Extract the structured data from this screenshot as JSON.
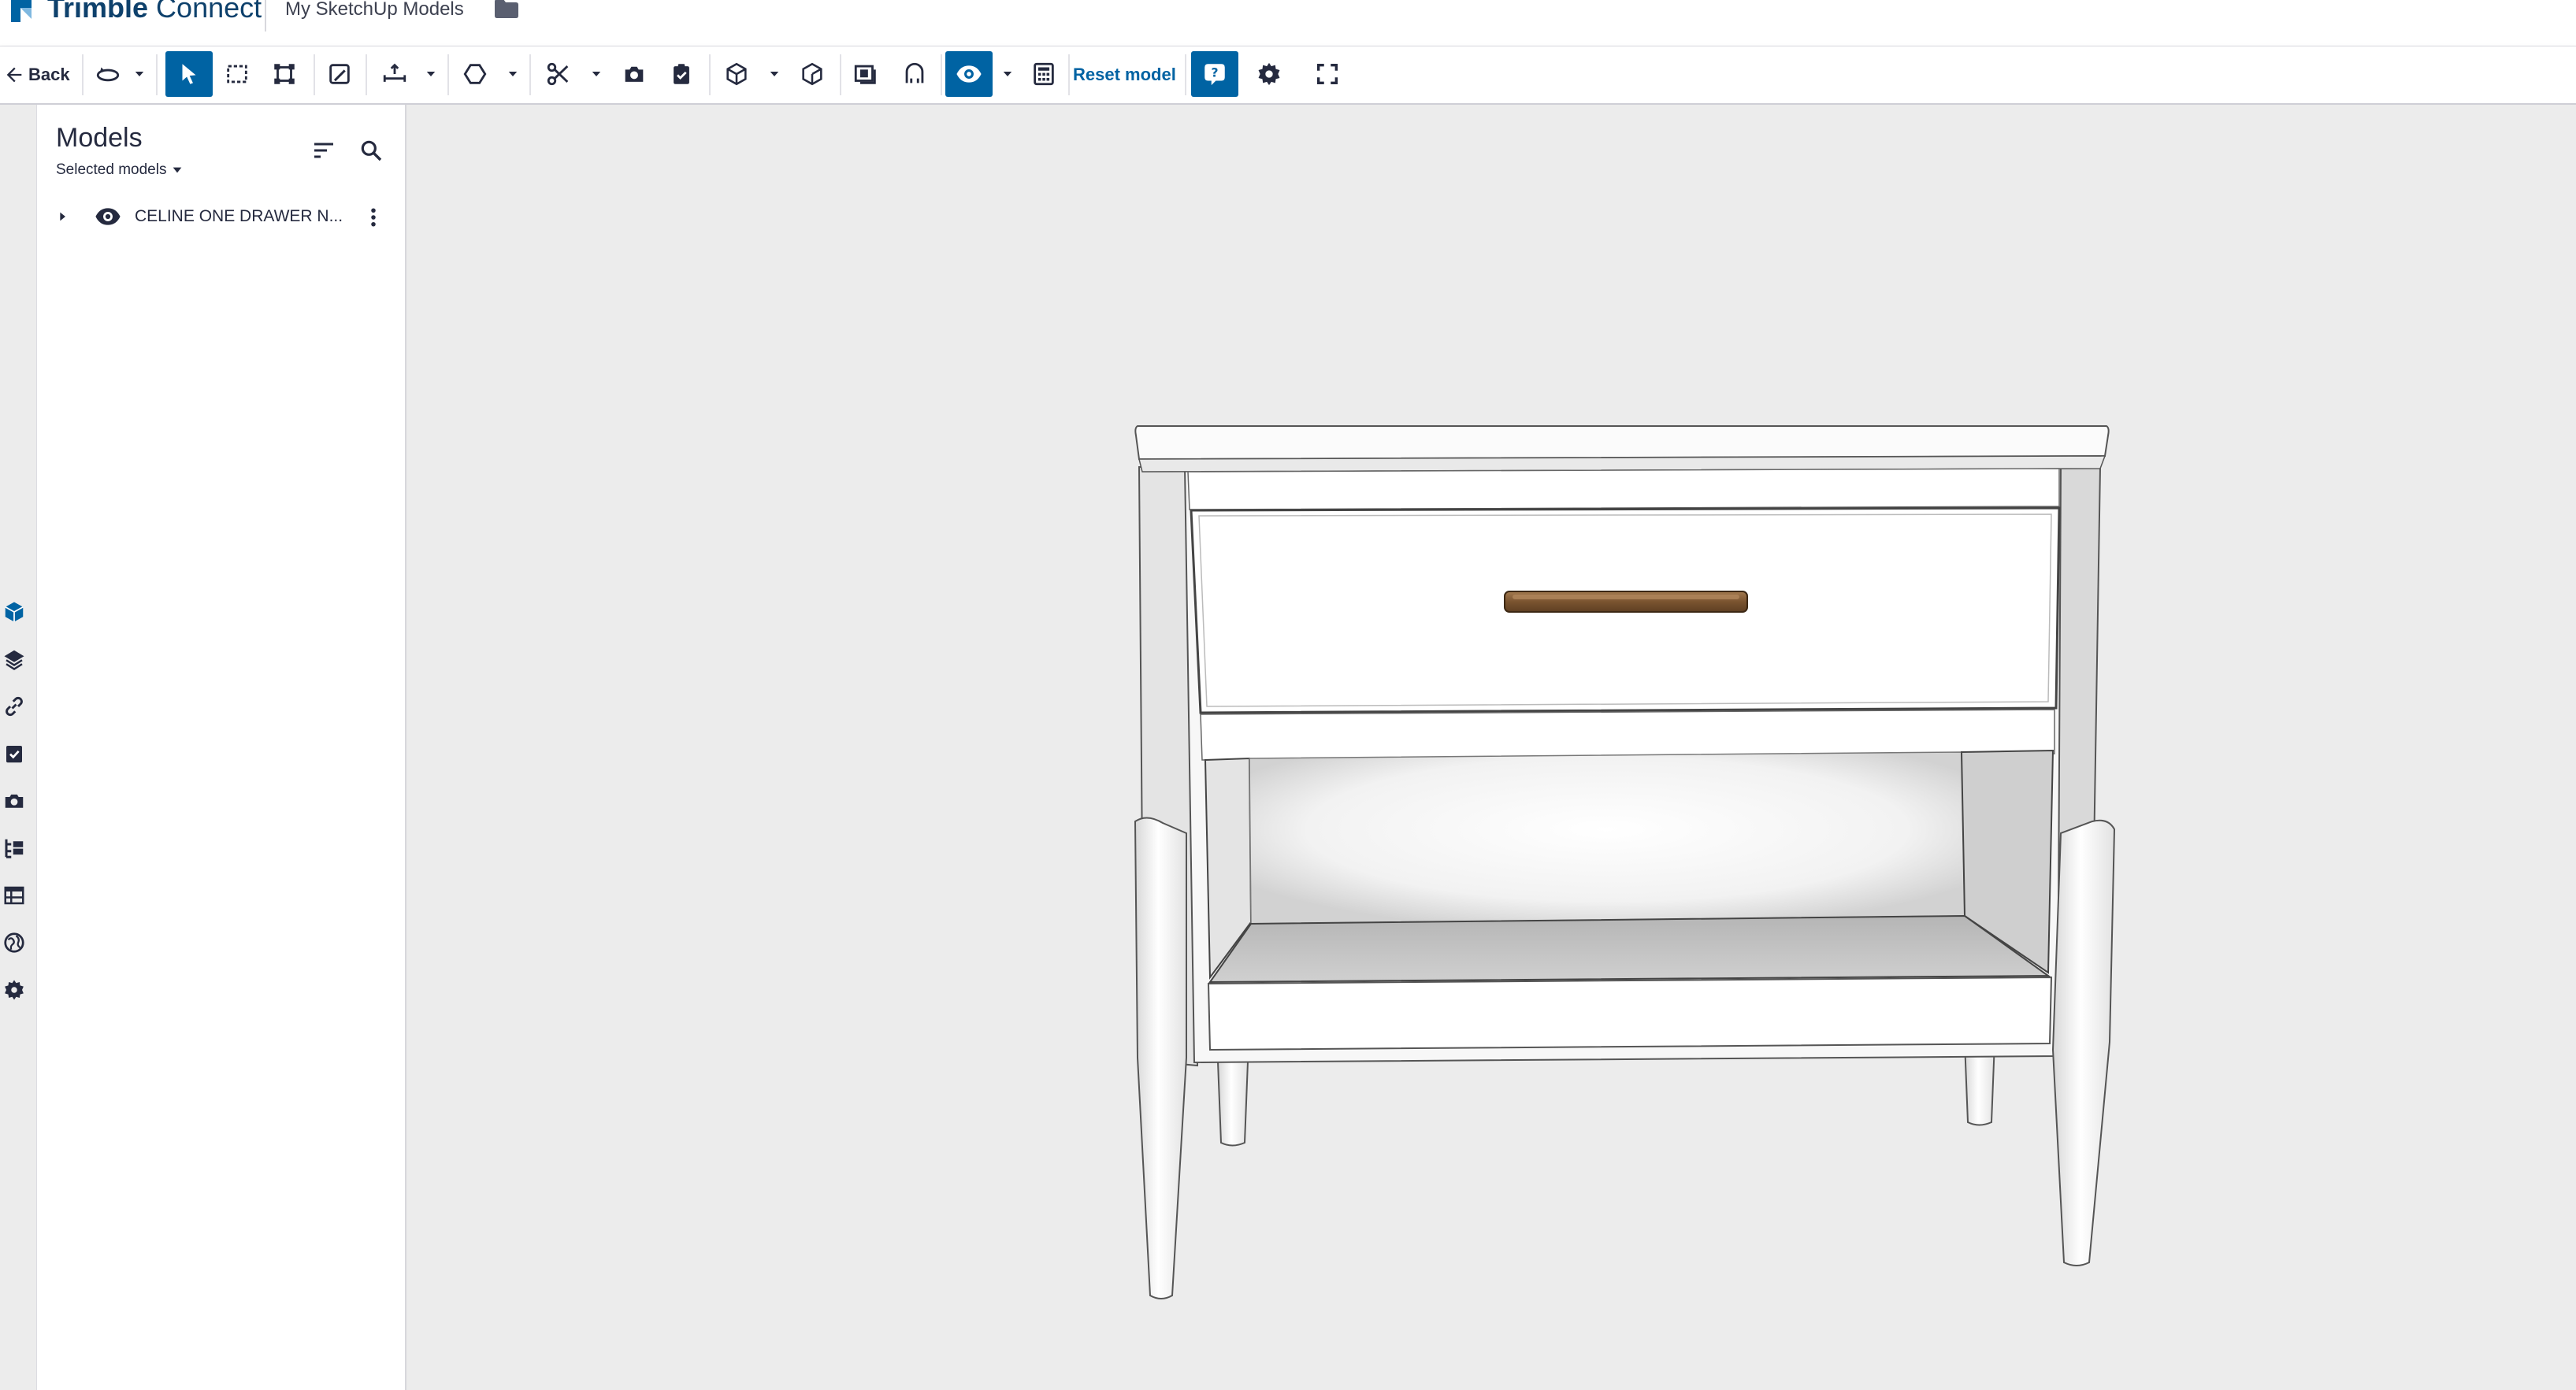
{
  "header": {
    "app_name_bold": "Trimble",
    "app_name_light": " Connect",
    "breadcrumb": "My SketchUp Models",
    "folder_icon": "folder-icon"
  },
  "toolbar": {
    "back_label": "Back",
    "reset_label": "Reset model",
    "accent_color": "#0063a3"
  },
  "left_rail": {
    "items": [
      "models-icon",
      "layers-icon",
      "link-icon",
      "todo-icon",
      "camera-icon",
      "hierarchy-icon",
      "table-icon",
      "globe-icon",
      "settings-icon"
    ],
    "active": "models-icon"
  },
  "models_panel": {
    "title": "Models",
    "filter_label": "Selected models",
    "items": [
      {
        "label": "CELINE ONE DRAWER N...",
        "visible": true
      }
    ]
  }
}
